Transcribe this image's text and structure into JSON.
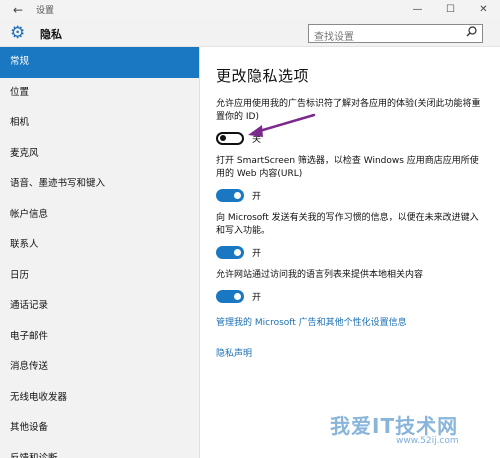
{
  "window": {
    "title": "设置",
    "back_icon": "back-arrow-icon",
    "controls": [
      "—",
      "☐",
      "✕"
    ]
  },
  "header": {
    "title": "隐私",
    "icon": "gear-icon",
    "search_placeholder": "查找设置"
  },
  "sidebar": {
    "items": [
      {
        "label": "常规",
        "active": true
      },
      {
        "label": "位置"
      },
      {
        "label": "相机"
      },
      {
        "label": "麦克风"
      },
      {
        "label": "语音、墨迹书写和键入"
      },
      {
        "label": "帐户信息"
      },
      {
        "label": "联系人"
      },
      {
        "label": "日历"
      },
      {
        "label": "通话记录"
      },
      {
        "label": "电子邮件"
      },
      {
        "label": "消息传送"
      },
      {
        "label": "无线电收发器"
      },
      {
        "label": "其他设备"
      },
      {
        "label": "反馈和诊断"
      }
    ]
  },
  "main": {
    "title": "更改隐私选项",
    "settings": [
      {
        "desc": "允许应用使用我的广告标识符了解对各应用的体验(关闭此功能将重置你的 ID)",
        "state": "关",
        "on": false
      },
      {
        "desc": "打开 SmartScreen 筛选器，以检查 Windows 应用商店应用所使用的 Web 内容(URL)",
        "state": "开",
        "on": true
      },
      {
        "desc": "向 Microsoft 发送有关我的写作习惯的信息，以便在未来改进键入和写入功能。",
        "state": "开",
        "on": true
      },
      {
        "desc": "允许网站通过访问我的语言列表来提供本地相关内容",
        "state": "开",
        "on": true
      }
    ],
    "link_manage": "管理我的 Microsoft 广告和其他个性化设置信息",
    "link_privacy": "隐私声明"
  },
  "watermark": {
    "text": "我爱IT技术网",
    "url": "www.52ij.com"
  },
  "colors": {
    "accent": "#1a78c2",
    "link": "#1a6fb5",
    "arrow": "#7b2a8c"
  }
}
